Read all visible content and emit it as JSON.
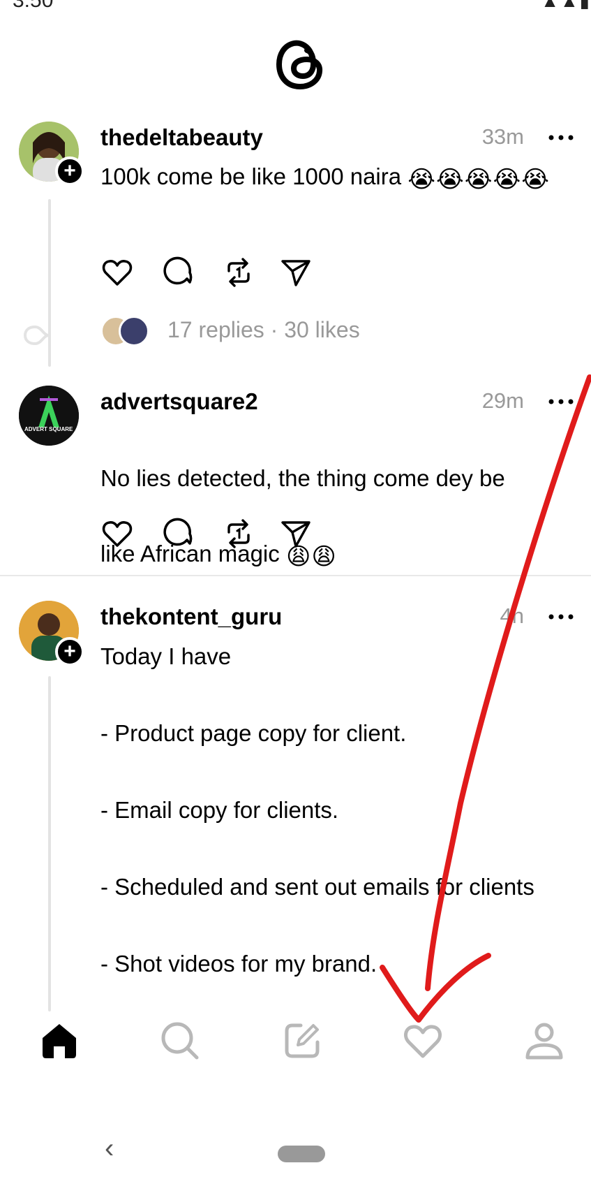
{
  "app": {
    "name": "Threads"
  },
  "status_bar": {
    "time": "3:50",
    "right_icons": "signal-wifi-battery"
  },
  "posts": [
    {
      "username": "thedeltabeauty",
      "time": "33m",
      "text": "100k come be like 1000 naira",
      "emoji": "😭😭😭😭😭",
      "replies_likes": "17 replies · 30 likes",
      "has_follow_badge": true
    },
    {
      "username": "advertsquare2",
      "time": "29m",
      "text_line1": "No lies detected,  the thing come dey be",
      "text_line2": "like African magic",
      "emoji": "😩😩",
      "avatar_text": "ADVERT SQUARE"
    },
    {
      "username": "thekontent_guru",
      "time": "4h",
      "text": "Today I have\n\n- Product page copy for client.\n\n- Email copy for clients.\n\n- Scheduled and sent out emails for clients\n\n- Shot videos for my brand.",
      "has_follow_badge": true
    }
  ],
  "icons": {
    "more": "more-options-icon",
    "like": "heart-icon",
    "comment": "comment-icon",
    "repost": "repost-icon",
    "share": "share-icon"
  },
  "bottom_nav": [
    {
      "name": "home",
      "icon": "home-icon",
      "active": true
    },
    {
      "name": "search",
      "icon": "search-icon",
      "active": false
    },
    {
      "name": "compose",
      "icon": "compose-icon",
      "active": false
    },
    {
      "name": "activity",
      "icon": "heart-icon",
      "active": false
    },
    {
      "name": "profile",
      "icon": "profile-icon",
      "active": false
    }
  ],
  "system_nav": {
    "back": "‹"
  },
  "colors": {
    "text": "#000000",
    "muted": "#999999",
    "annotation": "#e01b1b",
    "divider": "#e8e8e8"
  }
}
